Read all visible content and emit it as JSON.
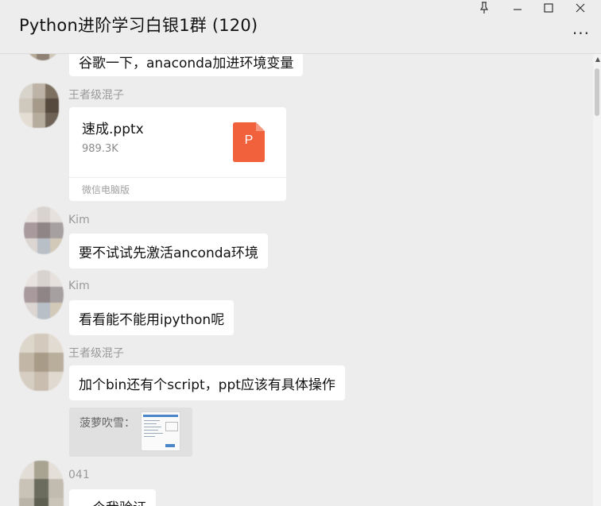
{
  "window": {
    "title": "Python进阶学习白银1群 (120)",
    "pin_icon": "pin-icon",
    "minimize_icon": "minimize-icon",
    "maximize_icon": "maximize-icon",
    "close_icon": "close-icon",
    "more_label": "···"
  },
  "messages": {
    "partial_top": {
      "text": "谷歌一下，anaconda加进环境变量"
    },
    "file_msg": {
      "sender": "王者级混子",
      "file_name": "速成.pptx",
      "file_size": "989.3K",
      "source": "微信电脑版",
      "file_icon_letter": "P",
      "file_icon_color": "#f0613c"
    },
    "msg1": {
      "sender": "Kim",
      "text": "要不试试先激活anconda环境"
    },
    "msg2": {
      "sender": "Kim",
      "text": "看看能不能用ipython呢"
    },
    "msg3": {
      "sender": "王者级混子",
      "text": "加个bin还有个script，ppt应该有具体操作",
      "quote_label": "菠萝吹雪："
    },
    "msg4": {
      "sender": "041",
      "text": "一个我验证"
    }
  }
}
